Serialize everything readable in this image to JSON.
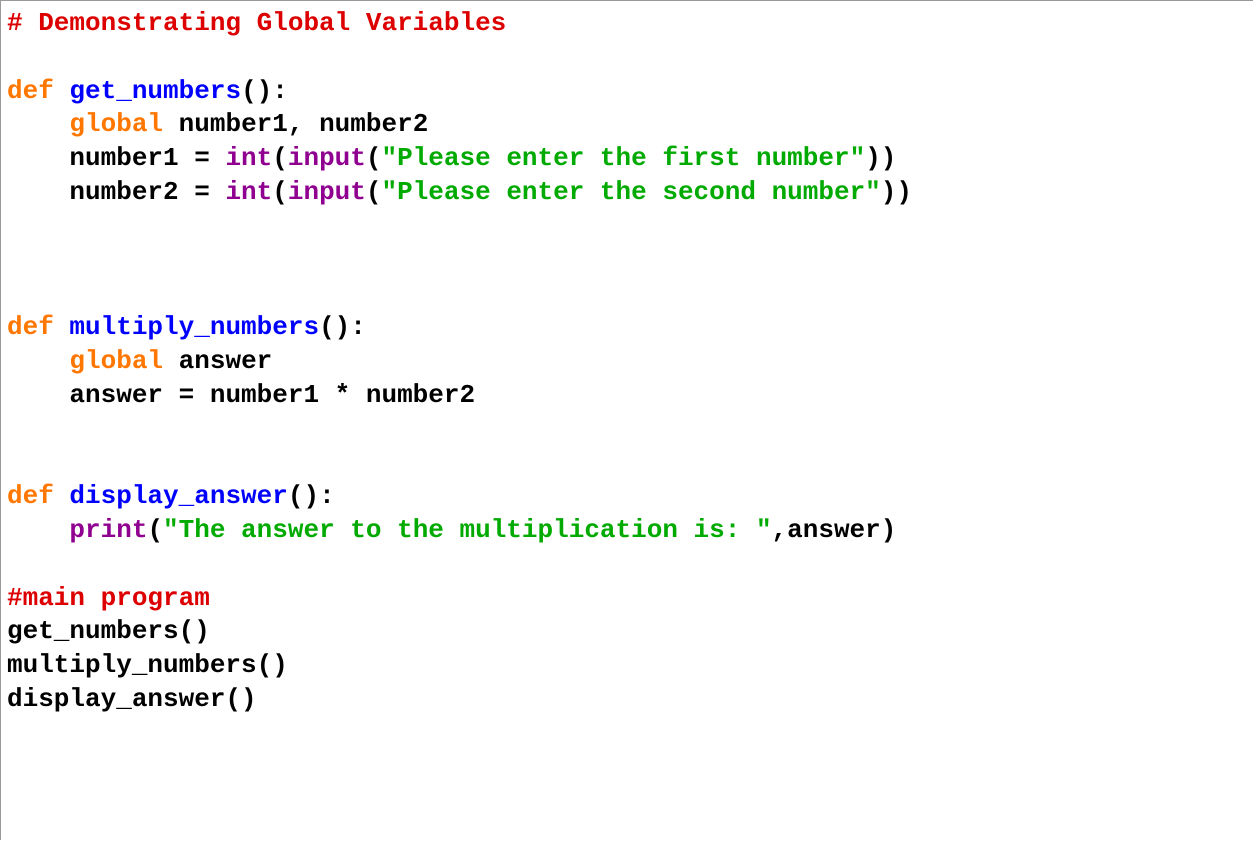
{
  "code": {
    "lines": [
      {
        "tokens": [
          {
            "cls": "tok-comment",
            "t": "# Demonstrating Global Variables"
          }
        ]
      },
      {
        "tokens": []
      },
      {
        "tokens": [
          {
            "cls": "tok-keyword",
            "t": "def"
          },
          {
            "cls": "tok-op",
            "t": " "
          },
          {
            "cls": "tok-defname",
            "t": "get_numbers"
          },
          {
            "cls": "tok-op",
            "t": "():"
          }
        ]
      },
      {
        "tokens": [
          {
            "cls": "tok-op",
            "t": "    "
          },
          {
            "cls": "tok-keyword",
            "t": "global"
          },
          {
            "cls": "tok-op",
            "t": " "
          },
          {
            "cls": "tok-name",
            "t": "number1, number2"
          }
        ]
      },
      {
        "tokens": [
          {
            "cls": "tok-op",
            "t": "    "
          },
          {
            "cls": "tok-name",
            "t": "number1 = "
          },
          {
            "cls": "tok-builtin",
            "t": "int"
          },
          {
            "cls": "tok-op",
            "t": "("
          },
          {
            "cls": "tok-builtin",
            "t": "input"
          },
          {
            "cls": "tok-op",
            "t": "("
          },
          {
            "cls": "tok-string",
            "t": "\"Please enter the first number\""
          },
          {
            "cls": "tok-op",
            "t": "))"
          }
        ]
      },
      {
        "tokens": [
          {
            "cls": "tok-op",
            "t": "    "
          },
          {
            "cls": "tok-name",
            "t": "number2 = "
          },
          {
            "cls": "tok-builtin",
            "t": "int"
          },
          {
            "cls": "tok-op",
            "t": "("
          },
          {
            "cls": "tok-builtin",
            "t": "input"
          },
          {
            "cls": "tok-op",
            "t": "("
          },
          {
            "cls": "tok-string",
            "t": "\"Please enter the second number\""
          },
          {
            "cls": "tok-op",
            "t": "))"
          }
        ]
      },
      {
        "tokens": []
      },
      {
        "tokens": []
      },
      {
        "tokens": []
      },
      {
        "tokens": [
          {
            "cls": "tok-keyword",
            "t": "def"
          },
          {
            "cls": "tok-op",
            "t": " "
          },
          {
            "cls": "tok-defname",
            "t": "multiply_numbers"
          },
          {
            "cls": "tok-op",
            "t": "():"
          }
        ]
      },
      {
        "tokens": [
          {
            "cls": "tok-op",
            "t": "    "
          },
          {
            "cls": "tok-keyword",
            "t": "global"
          },
          {
            "cls": "tok-op",
            "t": " "
          },
          {
            "cls": "tok-name",
            "t": "answer"
          }
        ]
      },
      {
        "tokens": [
          {
            "cls": "tok-op",
            "t": "    "
          },
          {
            "cls": "tok-name",
            "t": "answer = number1 * number2"
          }
        ]
      },
      {
        "tokens": []
      },
      {
        "tokens": []
      },
      {
        "tokens": [
          {
            "cls": "tok-keyword",
            "t": "def"
          },
          {
            "cls": "tok-op",
            "t": " "
          },
          {
            "cls": "tok-defname",
            "t": "display_answer"
          },
          {
            "cls": "tok-op",
            "t": "():"
          }
        ]
      },
      {
        "tokens": [
          {
            "cls": "tok-op",
            "t": "    "
          },
          {
            "cls": "tok-builtin",
            "t": "print"
          },
          {
            "cls": "tok-op",
            "t": "("
          },
          {
            "cls": "tok-string",
            "t": "\"The answer to the multiplication is: \""
          },
          {
            "cls": "tok-op",
            "t": ",answer)"
          }
        ]
      },
      {
        "tokens": []
      },
      {
        "tokens": [
          {
            "cls": "tok-comment",
            "t": "#main program"
          }
        ]
      },
      {
        "tokens": [
          {
            "cls": "tok-name",
            "t": "get_numbers()"
          }
        ]
      },
      {
        "tokens": [
          {
            "cls": "tok-name",
            "t": "multiply_numbers()"
          }
        ]
      },
      {
        "tokens": [
          {
            "cls": "tok-name",
            "t": "display_answer()"
          }
        ]
      }
    ]
  }
}
